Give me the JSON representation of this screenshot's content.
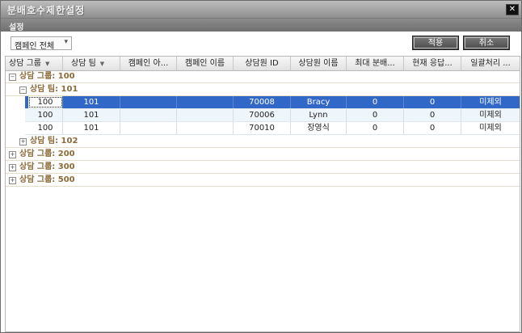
{
  "window": {
    "title": "분배호수제한설정",
    "close_glyph": "✕"
  },
  "section": {
    "label": "설정"
  },
  "toolbar": {
    "campaign_select": "캠페인 전체",
    "apply_label": "적용",
    "cancel_label": "취소"
  },
  "grid": {
    "columns": [
      "상담 그룹",
      "상담 팀",
      "캠페인 아...",
      "캠페인 이름",
      "상담원 ID",
      "상담원 이름",
      "최대 분배...",
      "현재 응답...",
      "일괄처리 ..."
    ],
    "groups": [
      {
        "label": "상담 그룹: 100",
        "toggle": "⊟"
      },
      {
        "label": "상담 그룹: 200",
        "toggle": "⊞"
      },
      {
        "label": "상담 그룹: 300",
        "toggle": "⊞"
      },
      {
        "label": "상담 그룹: 500",
        "toggle": "⊞"
      }
    ],
    "teams": [
      {
        "label": "상담 팀: 101",
        "toggle": "⊟"
      },
      {
        "label": "상담 팀: 102",
        "toggle": "⊞"
      }
    ],
    "rows": [
      {
        "group": "100",
        "team": "101",
        "campaign_id": "",
        "campaign_name": "",
        "agent_id": "70008",
        "agent_name": "Bracy",
        "max_dist": "0",
        "current_resp": "0",
        "batch": "미제외"
      },
      {
        "group": "100",
        "team": "101",
        "campaign_id": "",
        "campaign_name": "",
        "agent_id": "70006",
        "agent_name": "Lynn",
        "max_dist": "0",
        "current_resp": "0",
        "batch": "미제외"
      },
      {
        "group": "100",
        "team": "101",
        "campaign_id": "",
        "campaign_name": "",
        "agent_id": "70010",
        "agent_name": "장영식",
        "max_dist": "0",
        "current_resp": "0",
        "batch": "미제외"
      }
    ]
  }
}
